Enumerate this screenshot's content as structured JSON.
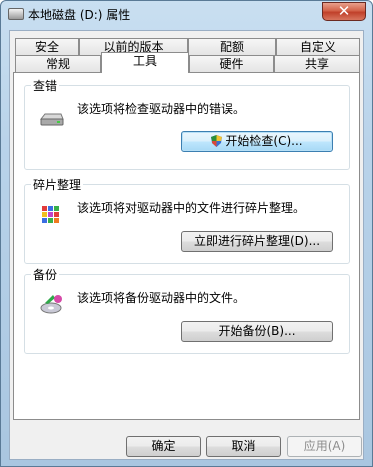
{
  "window": {
    "title": "本地磁盘 (D:) 属性",
    "close_glyph": "✕"
  },
  "tabs": {
    "row1": [
      "安全",
      "以前的版本",
      "配额",
      "自定义"
    ],
    "row2": [
      "常规",
      "工具",
      "硬件",
      "共享"
    ],
    "active": "工具"
  },
  "groups": [
    {
      "title": "查错",
      "description": "该选项将检查驱动器中的错误。",
      "button": "开始检查(C)...",
      "icon": "drive-check-icon"
    },
    {
      "title": "碎片整理",
      "description": "该选项将对驱动器中的文件进行碎片整理。",
      "button": "立即进行碎片整理(D)...",
      "icon": "defrag-icon"
    },
    {
      "title": "备份",
      "description": "该选项将备份驱动器中的文件。",
      "button": "开始备份(B)...",
      "icon": "backup-icon"
    }
  ],
  "buttons": {
    "ok": "确定",
    "cancel": "取消",
    "apply": "应用(A)"
  }
}
